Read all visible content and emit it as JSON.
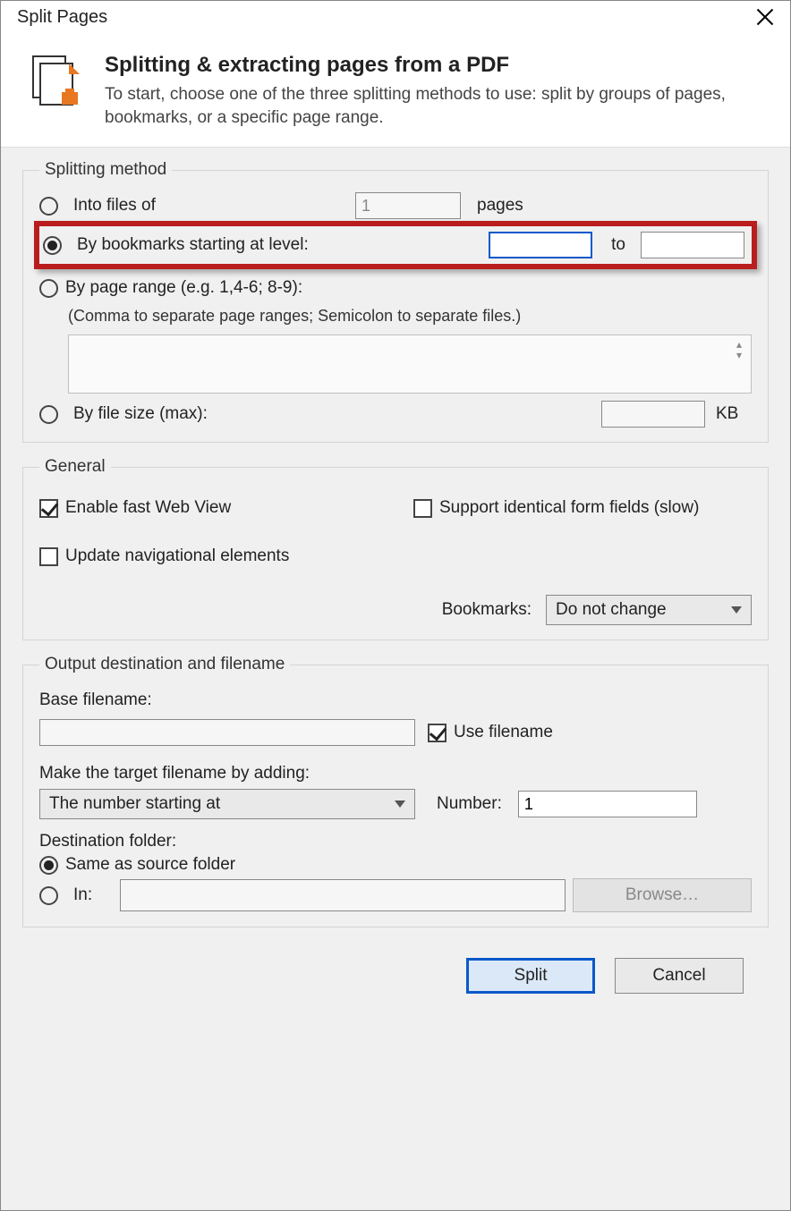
{
  "window": {
    "title": "Split Pages"
  },
  "header": {
    "heading": "Splitting & extracting pages from a PDF",
    "description": "To start, choose one of the three splitting methods to use: split by groups of pages, bookmarks, or a specific page range."
  },
  "splitting": {
    "legend": "Splitting method",
    "into_files": {
      "label": "Into files of",
      "value": "1",
      "unit": "pages",
      "selected": false
    },
    "by_bookmarks": {
      "label": "By bookmarks starting at level:",
      "from": "",
      "to_label": "to",
      "to": "",
      "selected": true
    },
    "by_page_range": {
      "label": "By page range (e.g. 1,4-6; 8-9):",
      "note": "(Comma to separate page ranges; Semicolon to separate files.)",
      "value": "",
      "selected": false
    },
    "by_file_size": {
      "label": "By file size (max):",
      "value": "",
      "unit": "KB",
      "selected": false
    }
  },
  "general": {
    "legend": "General",
    "enable_fast_web_view": {
      "label": "Enable fast Web View",
      "checked": true
    },
    "support_identical_form_fields": {
      "label": "Support identical form fields (slow)",
      "checked": false
    },
    "update_nav_elements": {
      "label": "Update navigational elements",
      "checked": false
    },
    "bookmarks": {
      "label": "Bookmarks:",
      "value": "Do not change"
    }
  },
  "output": {
    "legend": "Output destination and filename",
    "base_filename": {
      "label": "Base filename:",
      "value": ""
    },
    "use_filename": {
      "label": "Use filename",
      "checked": true
    },
    "make_target": {
      "label": "Make the target filename by adding:",
      "mode": "The number starting at",
      "number_label": "Number:",
      "number_value": "1"
    },
    "destination_folder": {
      "label": "Destination folder:",
      "same_as_source": {
        "label": "Same as source folder",
        "selected": true
      },
      "in": {
        "label": "In:",
        "path": "",
        "browse": "Browse…",
        "selected": false
      }
    }
  },
  "footer": {
    "split": "Split",
    "cancel": "Cancel"
  }
}
